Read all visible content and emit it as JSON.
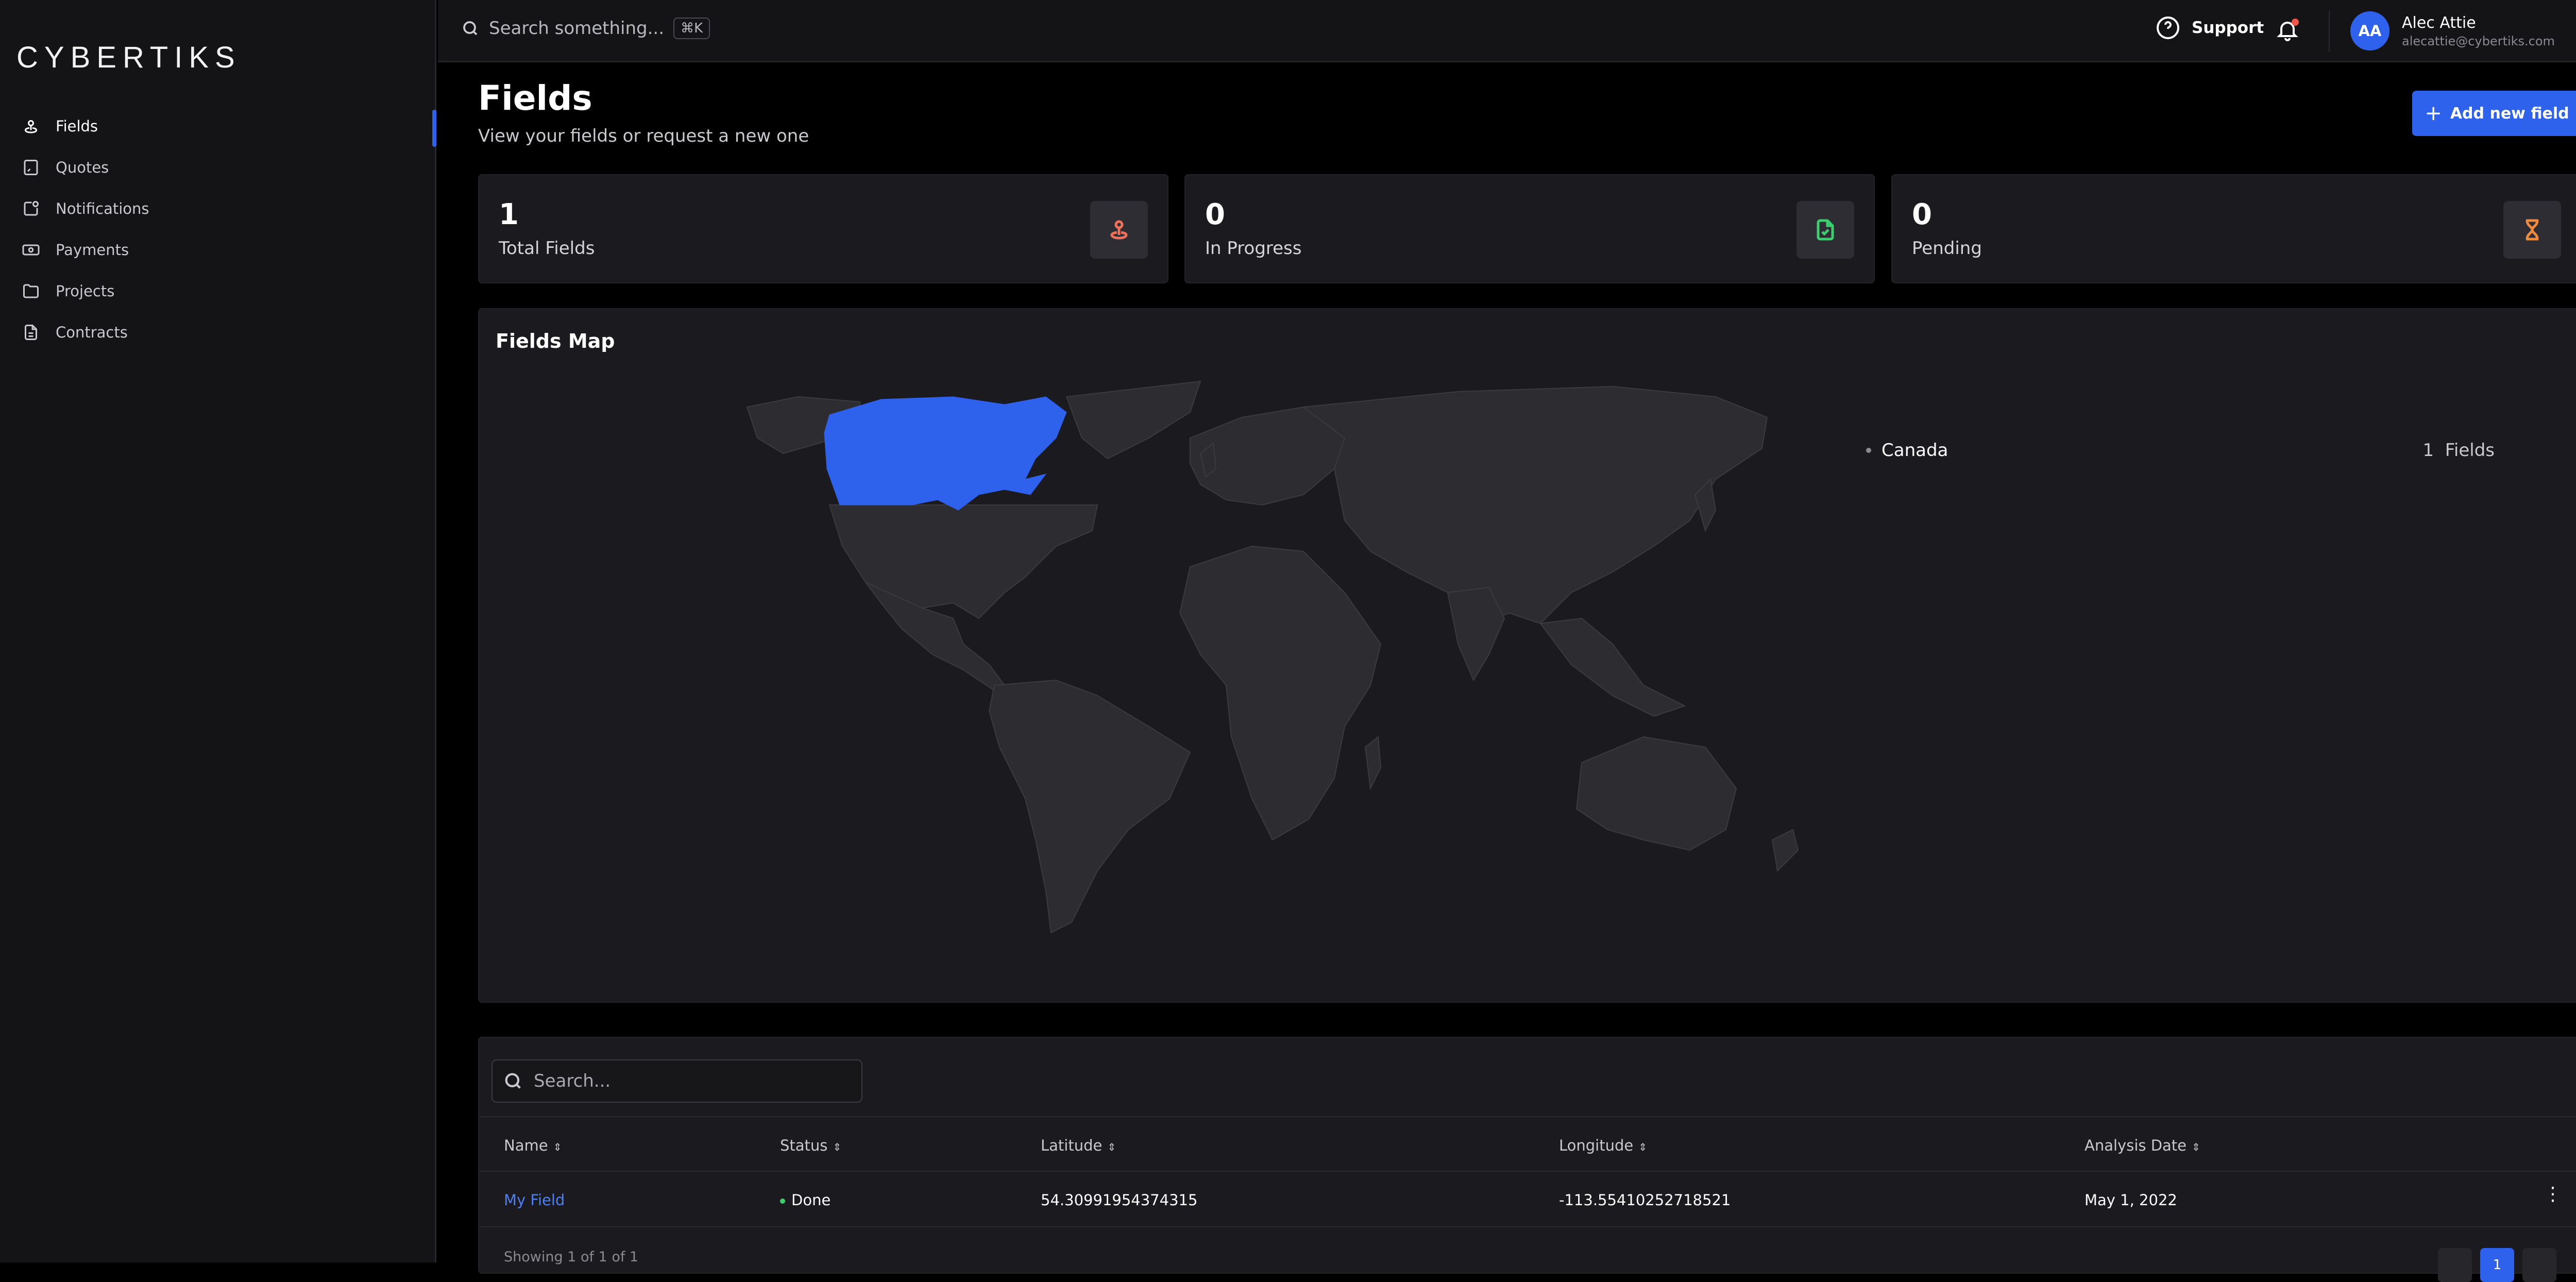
{
  "app": {
    "logo_text": "CYBERTIKS"
  },
  "sidebar": {
    "items": [
      {
        "label": "Fields",
        "icon": "map-pin-icon",
        "active": true
      },
      {
        "label": "Quotes",
        "icon": "quote-icon",
        "active": false
      },
      {
        "label": "Notifications",
        "icon": "notification-icon",
        "active": false
      },
      {
        "label": "Payments",
        "icon": "payments-icon",
        "active": false
      },
      {
        "label": "Projects",
        "icon": "folder-icon",
        "active": false
      },
      {
        "label": "Contracts",
        "icon": "document-icon",
        "active": false
      }
    ]
  },
  "topbar": {
    "search_placeholder": "Search something...",
    "search_shortcut": "⌘K",
    "support_label": "Support",
    "user": {
      "initials": "AA",
      "name": "Alec Attie",
      "email": "alecattie@cybertiks.com"
    }
  },
  "header": {
    "title": "Fields",
    "subtitle": "View your fields or request a new one",
    "add_button_label": "Add new field"
  },
  "stats": [
    {
      "value": "1",
      "label": "Total Fields",
      "icon": "map-pin-icon",
      "color": "#f0705a"
    },
    {
      "value": "0",
      "label": "In Progress",
      "icon": "file-check-icon",
      "color": "#3ccf6e"
    },
    {
      "value": "0",
      "label": "Pending",
      "icon": "hourglass-icon",
      "color": "#f08a3c"
    }
  ],
  "map": {
    "title": "Fields Map",
    "highlight_color": "#2f62ec",
    "base_color": "#2c2c31",
    "legend": [
      {
        "country": "Canada",
        "count": "1",
        "unit": "Fields"
      }
    ]
  },
  "table": {
    "search_placeholder": "Search...",
    "columns": [
      "Name",
      "Status",
      "Latitude",
      "Longitude",
      "Analysis Date"
    ],
    "rows": [
      {
        "name": "My Field",
        "status": "Done",
        "latitude": "54.30991954374315",
        "longitude": "-113.55410252718521",
        "analysis_date": "May 1, 2022"
      }
    ],
    "footer": "Showing 1 of 1 of 1",
    "current_page": "1"
  },
  "colors": {
    "accent": "#2f62ec",
    "status_done": "#3ccf6e"
  }
}
